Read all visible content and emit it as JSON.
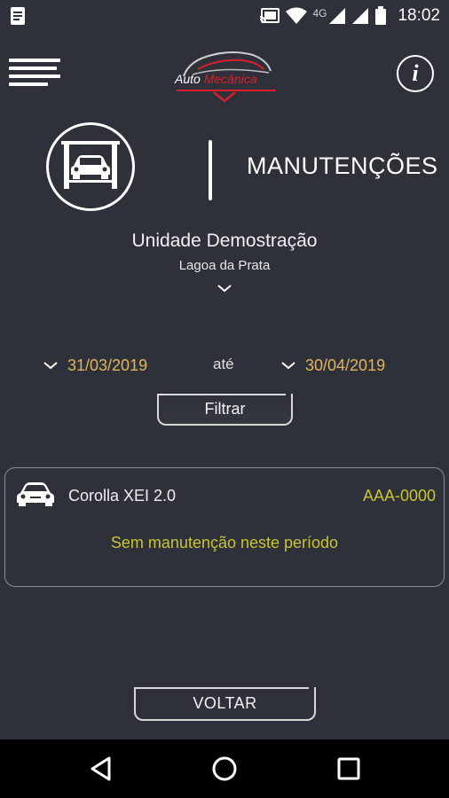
{
  "status_bar": {
    "time": "18:02",
    "network": "4G",
    "icons": [
      "notification-icon",
      "cast-icon",
      "wifi-icon",
      "signal-icon",
      "signal-icon",
      "battery-icon"
    ]
  },
  "header": {
    "logo": {
      "text_a": "Auto",
      "text_b": "Mecânica"
    },
    "menu_icon": "hamburger-menu-icon",
    "info_icon": "info-icon",
    "info_glyph": "i"
  },
  "section": {
    "title": "MANUTENÇÕES",
    "icon": "car-lift-icon"
  },
  "unit": {
    "name": "Unidade Demostração",
    "location": "Lagoa da Prata"
  },
  "filter": {
    "date_from": "31/03/2019",
    "separator": "até",
    "date_to": "30/04/2019",
    "button_label": "Filtrar"
  },
  "vehicles": [
    {
      "model": "Corolla XEI 2.0",
      "plate": "AAA-0000",
      "status": "Sem manutenção neste período"
    }
  ],
  "footer": {
    "back_label": "VOLTAR"
  },
  "colors": {
    "background": "#2e313a",
    "date_accent": "#e3b45a",
    "plate_accent": "#c8c531",
    "brand_red": "#d9202a"
  }
}
